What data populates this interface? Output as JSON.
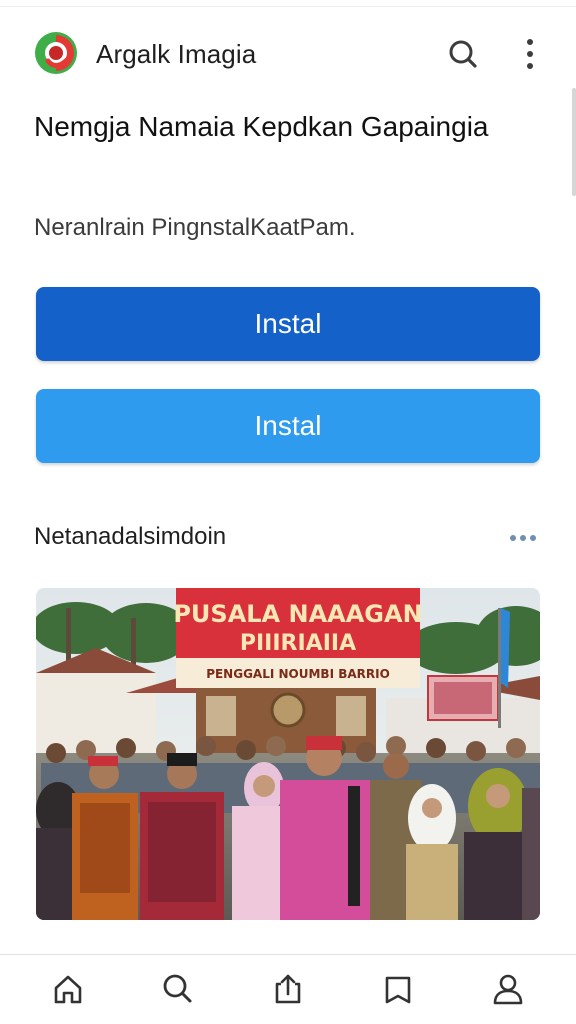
{
  "header": {
    "app_title": "Argalk Imagia",
    "logo_icon": "app-logo-icon",
    "search_icon": "search-icon",
    "more_icon": "more-vertical-icon"
  },
  "main": {
    "title": "Nemgja Namaia Kepdkan Gapaingia",
    "subtitle": "Neranlrain PingnstalKaatPam.",
    "primary_button": "Instal",
    "secondary_button": "Instal",
    "section_title": "Netanadalsimdoin",
    "photo": {
      "banner_line1": "PUSALA NAAAGAN",
      "banner_line2": "PIIIRIAIIA",
      "banner_line3": "PENGGALI NOUMBI BARRIO"
    }
  },
  "bottom_nav": {
    "items": [
      {
        "icon": "home-icon"
      },
      {
        "icon": "search-icon"
      },
      {
        "icon": "share-icon"
      },
      {
        "icon": "bookmark-icon"
      },
      {
        "icon": "profile-icon"
      }
    ]
  },
  "colors": {
    "primary_button": "#1461c9",
    "secondary_button": "#2f9bee",
    "banner_red": "#d8313c",
    "flag_blue": "#2e86d6"
  }
}
